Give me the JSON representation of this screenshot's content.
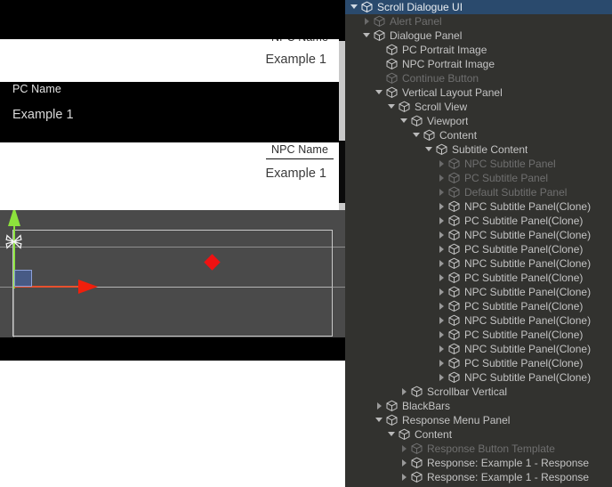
{
  "game_view": {
    "subtitles": [
      {
        "speaker_type": "pc",
        "name": "",
        "text": "",
        "clipped_top": true
      },
      {
        "speaker_type": "npc",
        "name": "NPC Name",
        "text": "Example 1"
      },
      {
        "speaker_type": "pc",
        "name": "PC Name",
        "text": "Example 1"
      },
      {
        "speaker_type": "npc",
        "name": "NPC Name",
        "text": "Example 1"
      }
    ],
    "scrollbar": {
      "name": "Scrollbar Vertical",
      "track_color": "#c9c9c9",
      "handle_color": "#0a0a0a"
    },
    "colors": {
      "npc_panel_bg": "#ffffff",
      "npc_panel_text": "#3b3b3b",
      "pc_panel_bg": "#000000",
      "pc_panel_text": "#d8d8d8",
      "blackbars": "#000000"
    }
  },
  "scene_view": {
    "background": "#4a4a4a",
    "gizmo": {
      "tool": "move-tool",
      "y_axis_color": "#8ce23c",
      "x_axis_color": "#f01f0c",
      "xy_plane_color": "#4664aa",
      "anchor_color": "#ef1212"
    },
    "selection_outline_color": "#c8c8c8"
  },
  "hierarchy": {
    "selection_color": "#2a4a6d",
    "background": "#32322f",
    "rows": [
      {
        "depth": 0,
        "label": "Scroll Dialogue UI",
        "twisty": "open",
        "selected": true,
        "disabled": false
      },
      {
        "depth": 1,
        "label": "Alert Panel",
        "twisty": "closed",
        "selected": false,
        "disabled": true
      },
      {
        "depth": 1,
        "label": "Dialogue Panel",
        "twisty": "open",
        "selected": false,
        "disabled": false
      },
      {
        "depth": 2,
        "label": "PC Portrait Image",
        "twisty": "none",
        "selected": false,
        "disabled": false
      },
      {
        "depth": 2,
        "label": "NPC Portrait Image",
        "twisty": "none",
        "selected": false,
        "disabled": false
      },
      {
        "depth": 2,
        "label": "Continue Button",
        "twisty": "none",
        "selected": false,
        "disabled": true
      },
      {
        "depth": 2,
        "label": "Vertical Layout Panel",
        "twisty": "open",
        "selected": false,
        "disabled": false
      },
      {
        "depth": 3,
        "label": "Scroll View",
        "twisty": "open",
        "selected": false,
        "disabled": false
      },
      {
        "depth": 4,
        "label": "Viewport",
        "twisty": "open",
        "selected": false,
        "disabled": false
      },
      {
        "depth": 5,
        "label": "Content",
        "twisty": "open",
        "selected": false,
        "disabled": false
      },
      {
        "depth": 6,
        "label": "Subtitle Content",
        "twisty": "open",
        "selected": false,
        "disabled": false
      },
      {
        "depth": 7,
        "label": "NPC Subtitle Panel",
        "twisty": "closed",
        "selected": false,
        "disabled": true
      },
      {
        "depth": 7,
        "label": "PC Subtitle Panel",
        "twisty": "closed",
        "selected": false,
        "disabled": true
      },
      {
        "depth": 7,
        "label": "Default Subtitle Panel",
        "twisty": "closed",
        "selected": false,
        "disabled": true
      },
      {
        "depth": 7,
        "label": "NPC Subtitle Panel(Clone)",
        "twisty": "closed",
        "selected": false,
        "disabled": false
      },
      {
        "depth": 7,
        "label": "PC Subtitle Panel(Clone)",
        "twisty": "closed",
        "selected": false,
        "disabled": false
      },
      {
        "depth": 7,
        "label": "NPC Subtitle Panel(Clone)",
        "twisty": "closed",
        "selected": false,
        "disabled": false
      },
      {
        "depth": 7,
        "label": "PC Subtitle Panel(Clone)",
        "twisty": "closed",
        "selected": false,
        "disabled": false
      },
      {
        "depth": 7,
        "label": "NPC Subtitle Panel(Clone)",
        "twisty": "closed",
        "selected": false,
        "disabled": false
      },
      {
        "depth": 7,
        "label": "PC Subtitle Panel(Clone)",
        "twisty": "closed",
        "selected": false,
        "disabled": false
      },
      {
        "depth": 7,
        "label": "NPC Subtitle Panel(Clone)",
        "twisty": "closed",
        "selected": false,
        "disabled": false
      },
      {
        "depth": 7,
        "label": "PC Subtitle Panel(Clone)",
        "twisty": "closed",
        "selected": false,
        "disabled": false
      },
      {
        "depth": 7,
        "label": "NPC Subtitle Panel(Clone)",
        "twisty": "closed",
        "selected": false,
        "disabled": false
      },
      {
        "depth": 7,
        "label": "PC Subtitle Panel(Clone)",
        "twisty": "closed",
        "selected": false,
        "disabled": false
      },
      {
        "depth": 7,
        "label": "NPC Subtitle Panel(Clone)",
        "twisty": "closed",
        "selected": false,
        "disabled": false
      },
      {
        "depth": 7,
        "label": "PC Subtitle Panel(Clone)",
        "twisty": "closed",
        "selected": false,
        "disabled": false
      },
      {
        "depth": 7,
        "label": "NPC Subtitle Panel(Clone)",
        "twisty": "closed",
        "selected": false,
        "disabled": false
      },
      {
        "depth": 4,
        "label": "Scrollbar Vertical",
        "twisty": "closed",
        "selected": false,
        "disabled": false
      },
      {
        "depth": 2,
        "label": "BlackBars",
        "twisty": "closed",
        "selected": false,
        "disabled": false
      },
      {
        "depth": 2,
        "label": "Response Menu Panel",
        "twisty": "open",
        "selected": false,
        "disabled": false
      },
      {
        "depth": 3,
        "label": "Content",
        "twisty": "open",
        "selected": false,
        "disabled": false
      },
      {
        "depth": 4,
        "label": "Response Button Template",
        "twisty": "closed",
        "selected": false,
        "disabled": true
      },
      {
        "depth": 4,
        "label": "Response: Example 1 - Response",
        "twisty": "closed",
        "selected": false,
        "disabled": false
      },
      {
        "depth": 4,
        "label": "Response: Example 1 - Response",
        "twisty": "closed",
        "selected": false,
        "disabled": false
      }
    ]
  }
}
